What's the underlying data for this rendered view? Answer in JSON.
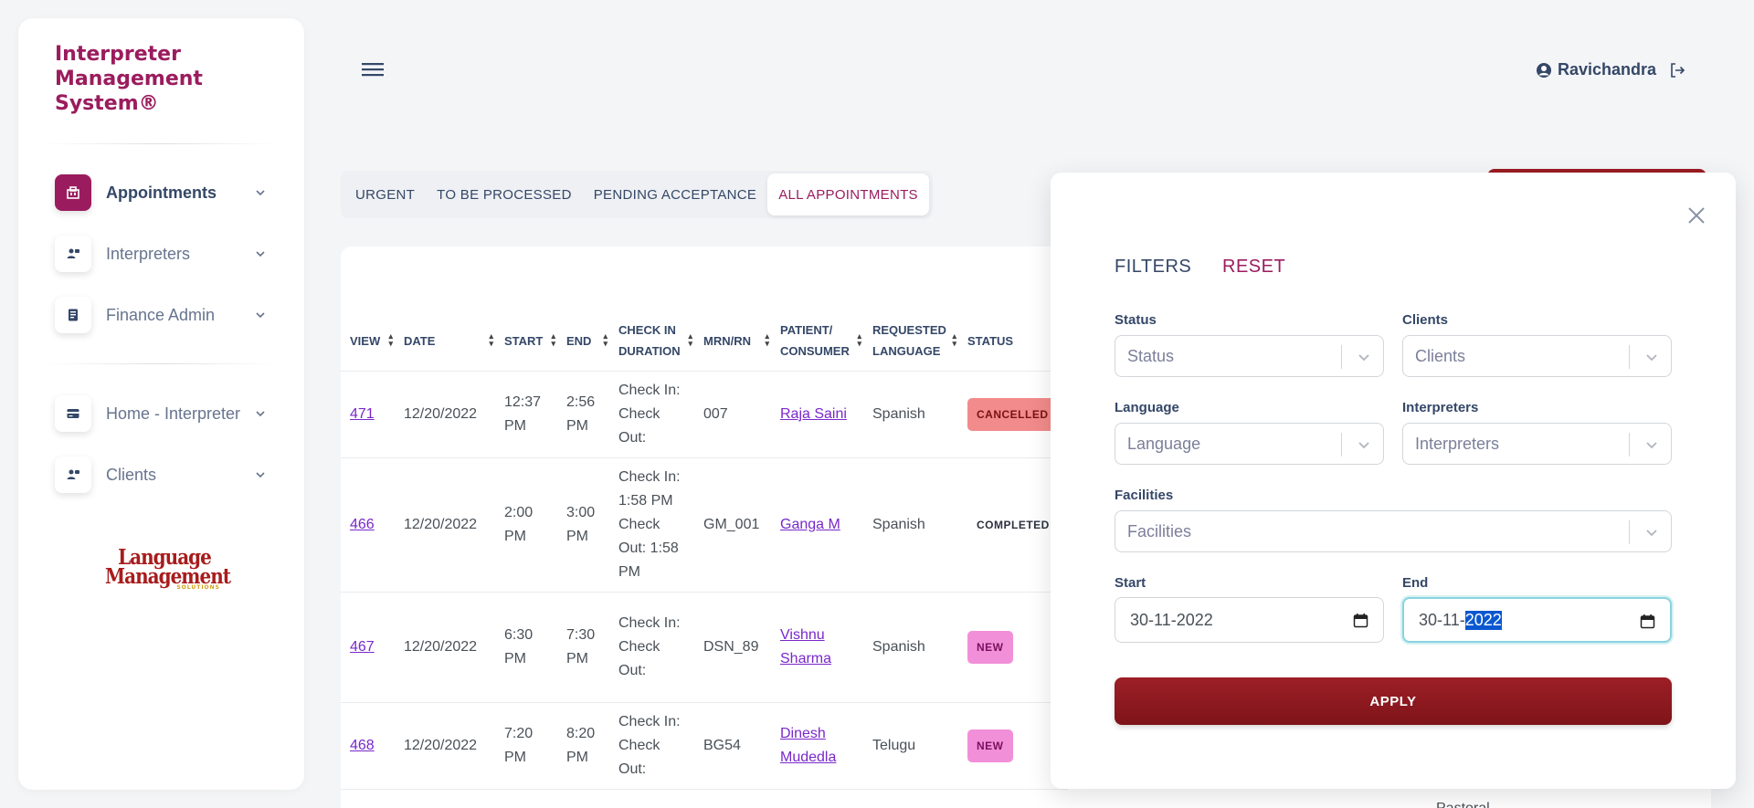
{
  "brand": {
    "line1": "Interpreter",
    "line2": "Management",
    "line3": "System®"
  },
  "sidebar": {
    "items": [
      {
        "label": "Appointments",
        "icon": "appointments-icon",
        "active": true
      },
      {
        "label": "Interpreters",
        "icon": "interpreter-icon",
        "active": false
      },
      {
        "label": "Finance Admin",
        "icon": "finance-icon",
        "active": false
      },
      {
        "label": "Home - Interpreter",
        "icon": "card-icon",
        "active": false
      },
      {
        "label": "Clients",
        "icon": "clients-icon",
        "active": false
      }
    ],
    "logo": {
      "line1": "Language",
      "line2": "Management",
      "line3": "SOLUTIONS"
    }
  },
  "header": {
    "user_name": "Ravichandra"
  },
  "tabs": [
    {
      "label": "URGENT",
      "active": false
    },
    {
      "label": "TO BE PROCESSED",
      "active": false
    },
    {
      "label": "PENDING ACCEPTANCE",
      "active": false
    },
    {
      "label": "ALL APPOINTMENTS",
      "active": true
    }
  ],
  "table": {
    "headers": [
      {
        "l1": "VIEW",
        "l2": ""
      },
      {
        "l1": "DATE",
        "l2": ""
      },
      {
        "l1": "START",
        "l2": ""
      },
      {
        "l1": "END",
        "l2": ""
      },
      {
        "l1": "CHECK IN",
        "l2": "DURATION"
      },
      {
        "l1": "MRN/RN",
        "l2": ""
      },
      {
        "l1": "PATIENT/",
        "l2": "CONSUMER"
      },
      {
        "l1": "REQUESTED",
        "l2": "LANGUAGE"
      },
      {
        "l1": "STATUS",
        "l2": ""
      }
    ],
    "rows": [
      {
        "view": "471",
        "date": "12/20/2022",
        "start1": "12:37",
        "start2": "PM",
        "end1": "2:56",
        "end2": "PM",
        "check": [
          "Check In:",
          "Check",
          "Out:"
        ],
        "mrn": "007",
        "patient": [
          "Raja Saini"
        ],
        "language": "Spanish",
        "status": "CANCELLED",
        "status_kind": "cancelled"
      },
      {
        "view": "466",
        "date": "12/20/2022",
        "start1": "2:00",
        "start2": "PM",
        "end1": "3:00",
        "end2": "PM",
        "check": [
          "Check In:",
          "1:58 PM",
          "Check",
          "Out: 1:58",
          "PM"
        ],
        "mrn": "GM_001",
        "patient": [
          "Ganga M"
        ],
        "language": "Spanish",
        "status": "COMPLETED",
        "status_kind": "completed"
      },
      {
        "view": "467",
        "date": "12/20/2022",
        "start1": "6:30",
        "start2": "PM",
        "end1": "7:30",
        "end2": "PM",
        "check": [
          "Check In:",
          "Check",
          "Out:"
        ],
        "mrn": "DSN_89",
        "patient": [
          "Vishnu",
          "Sharma"
        ],
        "language": "Spanish",
        "status": "NEW",
        "status_kind": "new"
      },
      {
        "view": "468",
        "date": "12/20/2022",
        "start1": "7:20",
        "start2": "PM",
        "end1": "8:20",
        "end2": "PM",
        "check": [
          "Check In:",
          "Check",
          "Out:"
        ],
        "mrn": "BG54",
        "patient": [
          "Dinesh",
          "Mudedla"
        ],
        "language": "Telugu",
        "status": "NEW",
        "status_kind": "new"
      }
    ],
    "cut_text": "Pastoral"
  },
  "filters": {
    "title": "FILTERS",
    "reset": "RESET",
    "status": {
      "label": "Status",
      "placeholder": "Status"
    },
    "clients": {
      "label": "Clients",
      "placeholder": "Clients"
    },
    "language": {
      "label": "Language",
      "placeholder": "Language"
    },
    "interpreters": {
      "label": "Interpreters",
      "placeholder": "Interpreters"
    },
    "facilities": {
      "label": "Facilities",
      "placeholder": "Facilities"
    },
    "start": {
      "label": "Start",
      "value": "30-11-2022"
    },
    "end": {
      "label": "End",
      "value_prefix": "30-11-",
      "value_selected": "2022"
    },
    "apply": "APPLY"
  },
  "colors": {
    "accent": "#9b1c5e",
    "apply": "#8a1a20",
    "link": "#7928ca"
  }
}
